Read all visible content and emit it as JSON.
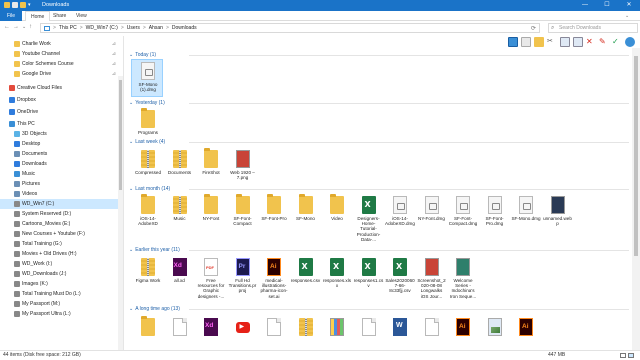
{
  "window": {
    "title": "Downloads",
    "controls": {
      "minimize": "—",
      "maximize": "☐",
      "close": "✕"
    }
  },
  "ribbon": {
    "tabs": [
      "File",
      "Home",
      "Share",
      "View"
    ]
  },
  "address": {
    "path": [
      "This PC",
      "WD_Win7 (C:)",
      "Users",
      "Ahsan",
      "Downloads"
    ],
    "separator": ">",
    "search_placeholder": "Search Downloads"
  },
  "sidebar": {
    "items": [
      {
        "label": "Charlie Work",
        "pinned": true,
        "color": "#f1c34d"
      },
      {
        "label": "Youtube Channel",
        "pinned": true,
        "color": "#f1c34d"
      },
      {
        "label": "Color Schemes Course",
        "pinned": true,
        "color": "#f1c34d"
      },
      {
        "label": "Google Drive",
        "pinned": true,
        "color": "#f1c34d"
      },
      {
        "label": "Creative Cloud Files",
        "pinned": false,
        "color": "#e34b3c"
      },
      {
        "label": "Dropbox",
        "pinned": false,
        "color": "#2f7cdd"
      },
      {
        "label": "OneDrive",
        "pinned": false,
        "color": "#2f7cdd"
      },
      {
        "label": "This PC",
        "pinned": false,
        "color": "#3a8fd6"
      },
      {
        "label": "3D Objects",
        "pinned": false,
        "color": "#5bb3e6"
      },
      {
        "label": "Desktop",
        "pinned": false,
        "color": "#2f7cdd"
      },
      {
        "label": "Documents",
        "pinned": false,
        "color": "#6b8fb5"
      },
      {
        "label": "Downloads",
        "pinned": false,
        "color": "#2f7cdd"
      },
      {
        "label": "Music",
        "pinned": false,
        "color": "#3a8fd6"
      },
      {
        "label": "Pictures",
        "pinned": false,
        "color": "#6b8fb5"
      },
      {
        "label": "Videos",
        "pinned": false,
        "color": "#6b8fb5"
      },
      {
        "label": "WD_Win7 (C:)",
        "pinned": false,
        "color": "#888888",
        "selected": true
      },
      {
        "label": "System Reserved (D:)",
        "pinned": false,
        "color": "#888888"
      },
      {
        "label": "Cartoons_Movies (E:)",
        "pinned": false,
        "color": "#888888"
      },
      {
        "label": "New Courses + Youtube (F:)",
        "pinned": false,
        "color": "#888888"
      },
      {
        "label": "Total Training (G:)",
        "pinned": false,
        "color": "#888888"
      },
      {
        "label": "Movies + Old Drives (H:)",
        "pinned": false,
        "color": "#888888"
      },
      {
        "label": "WD_Work (I:)",
        "pinned": false,
        "color": "#888888"
      },
      {
        "label": "WD_Downloads (J:)",
        "pinned": false,
        "color": "#888888"
      },
      {
        "label": "Images (K:)",
        "pinned": false,
        "color": "#888888"
      },
      {
        "label": "Total Training Must Do (L:)",
        "pinned": false,
        "color": "#888888"
      },
      {
        "label": "My Passport (M:)",
        "pinned": false,
        "color": "#888888"
      },
      {
        "label": "My Passport Ultra (L:)",
        "pinned": false,
        "color": "#888888"
      }
    ]
  },
  "groups": [
    {
      "header": "Today (1)",
      "files": [
        {
          "name": "SF-Mono (1).dmg",
          "icon": "dmg",
          "selected": true
        }
      ]
    },
    {
      "header": "Yesterday (1)",
      "files": [
        {
          "name": "Programs",
          "icon": "folder"
        }
      ]
    },
    {
      "header": "Last week (4)",
      "files": [
        {
          "name": "Compressed",
          "icon": "zip"
        },
        {
          "name": "Documents",
          "icon": "zip"
        },
        {
          "name": "FireShot",
          "icon": "folder"
        },
        {
          "name": "Web 1920 – 7.png",
          "icon": "img-red"
        }
      ]
    },
    {
      "header": "Last month (14)",
      "files": [
        {
          "name": "iOS-14-AdobeXD",
          "icon": "folder"
        },
        {
          "name": "Music",
          "icon": "zip"
        },
        {
          "name": "NY-Font",
          "icon": "folder"
        },
        {
          "name": "SF-Font-Compact",
          "icon": "folder"
        },
        {
          "name": "SF-Font-Pro",
          "icon": "folder"
        },
        {
          "name": "SF-Mono",
          "icon": "folder"
        },
        {
          "name": "Video",
          "icon": "folder"
        },
        {
          "name": "Designers-Home-Tutorial-Production-Data-...",
          "icon": "xl"
        },
        {
          "name": "iOS-14-AdobeXD.dmg",
          "icon": "dmg"
        },
        {
          "name": "NY-Font.dmg",
          "icon": "dmg"
        },
        {
          "name": "SF-Font-Compact.dmg",
          "icon": "dmg"
        },
        {
          "name": "SF-Font-Pro.dmg",
          "icon": "dmg"
        },
        {
          "name": "SF-Mono.dmg",
          "icon": "dmg"
        },
        {
          "name": "unnamed.webp",
          "icon": "img-dark"
        }
      ]
    },
    {
      "header": "Earlier this year (11)",
      "files": [
        {
          "name": "Figma Work",
          "icon": "zip"
        },
        {
          "name": "all.xd",
          "icon": "xd"
        },
        {
          "name": "Free resources for Graphic designers -...",
          "icon": "pdf"
        },
        {
          "name": "Full Hd Transitions.prproj",
          "icon": "pr"
        },
        {
          "name": "medical-illustrations-pharma-icon-set.ai",
          "icon": "ai"
        },
        {
          "name": "responses.csv",
          "icon": "xl"
        },
        {
          "name": "responses.xlsx",
          "icon": "xl"
        },
        {
          "name": "responses1.csv",
          "icon": "xl"
        },
        {
          "name": "Sales20200607-66-8c33fjj.csv",
          "icon": "xl"
        },
        {
          "name": "Screenshot_2020-08-08 Longwalks iOS Jour...",
          "icon": "img-red"
        },
        {
          "name": "Welcome Series - Indochina's Iron Seque...",
          "icon": "img-teal"
        }
      ]
    },
    {
      "header": "A long time ago (13)",
      "files": [
        {
          "name": "",
          "icon": "folder"
        },
        {
          "name": "",
          "icon": "doc"
        },
        {
          "name": "",
          "icon": "xd"
        },
        {
          "name": "",
          "icon": "yt"
        },
        {
          "name": "",
          "icon": "doc"
        },
        {
          "name": "",
          "icon": "zip"
        },
        {
          "name": "",
          "icon": "img-swatch"
        },
        {
          "name": "",
          "icon": "doc"
        },
        {
          "name": "",
          "icon": "word"
        },
        {
          "name": "",
          "icon": "doc"
        },
        {
          "name": "",
          "icon": "ai"
        },
        {
          "name": "",
          "icon": "pic"
        },
        {
          "name": "",
          "icon": "ai"
        }
      ]
    }
  ],
  "status": {
    "left": "44 items   (Disk free space: 212 GB)",
    "right": "447 MB"
  },
  "colors": {
    "titlebar": "#1a73c8",
    "selection": "#cce8ff",
    "group_header": "#1d5fa8"
  }
}
